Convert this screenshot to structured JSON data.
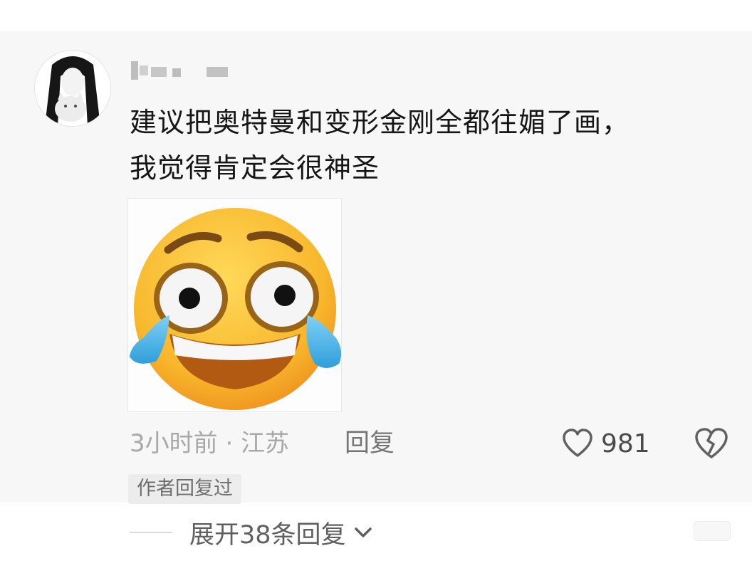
{
  "comment": {
    "username": "",
    "text_lines": [
      "建议把奥特曼和变形金刚全都往媚了画，",
      "我觉得肯定会很神圣"
    ],
    "sticker_icon": "crying-laughing-emoji",
    "meta": "3小时前 · 江苏",
    "reply_label": "回复",
    "like_count": "981",
    "like_icon": "heart-outline-icon",
    "dislike_icon": "broken-heart-icon",
    "author_badge": "作者回复过",
    "expand_label": "展开38条回复"
  },
  "colors": {
    "card_bg": "#f7f7f7",
    "text": "#161616",
    "meta": "#a8a8a8",
    "emoji_face": "#f8b72c",
    "tear": "#39a9e1"
  }
}
